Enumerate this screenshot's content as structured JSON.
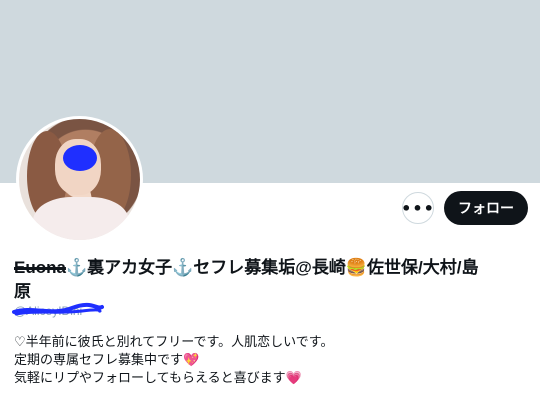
{
  "profile": {
    "banner_color": "#cfd9de",
    "display_name_redacted": "Euona",
    "display_name_line1": "⚓裏アカ女子⚓セフレ募集垢@長崎🍔佐世保/大村/島",
    "display_name_line2": "原",
    "handle": "@AliceyIDini",
    "bio": [
      "♡半年前に彼氏と別れてフリーです。人肌恋しいです。",
      "定期の専属セフレ募集中です💖",
      "気軽にリプやフォローしてもらえると喜びます💗"
    ]
  },
  "actions": {
    "more_label": "•••",
    "follow_label": "フォロー"
  },
  "icons": {
    "more": "more-icon",
    "avatar": "avatar-image"
  }
}
